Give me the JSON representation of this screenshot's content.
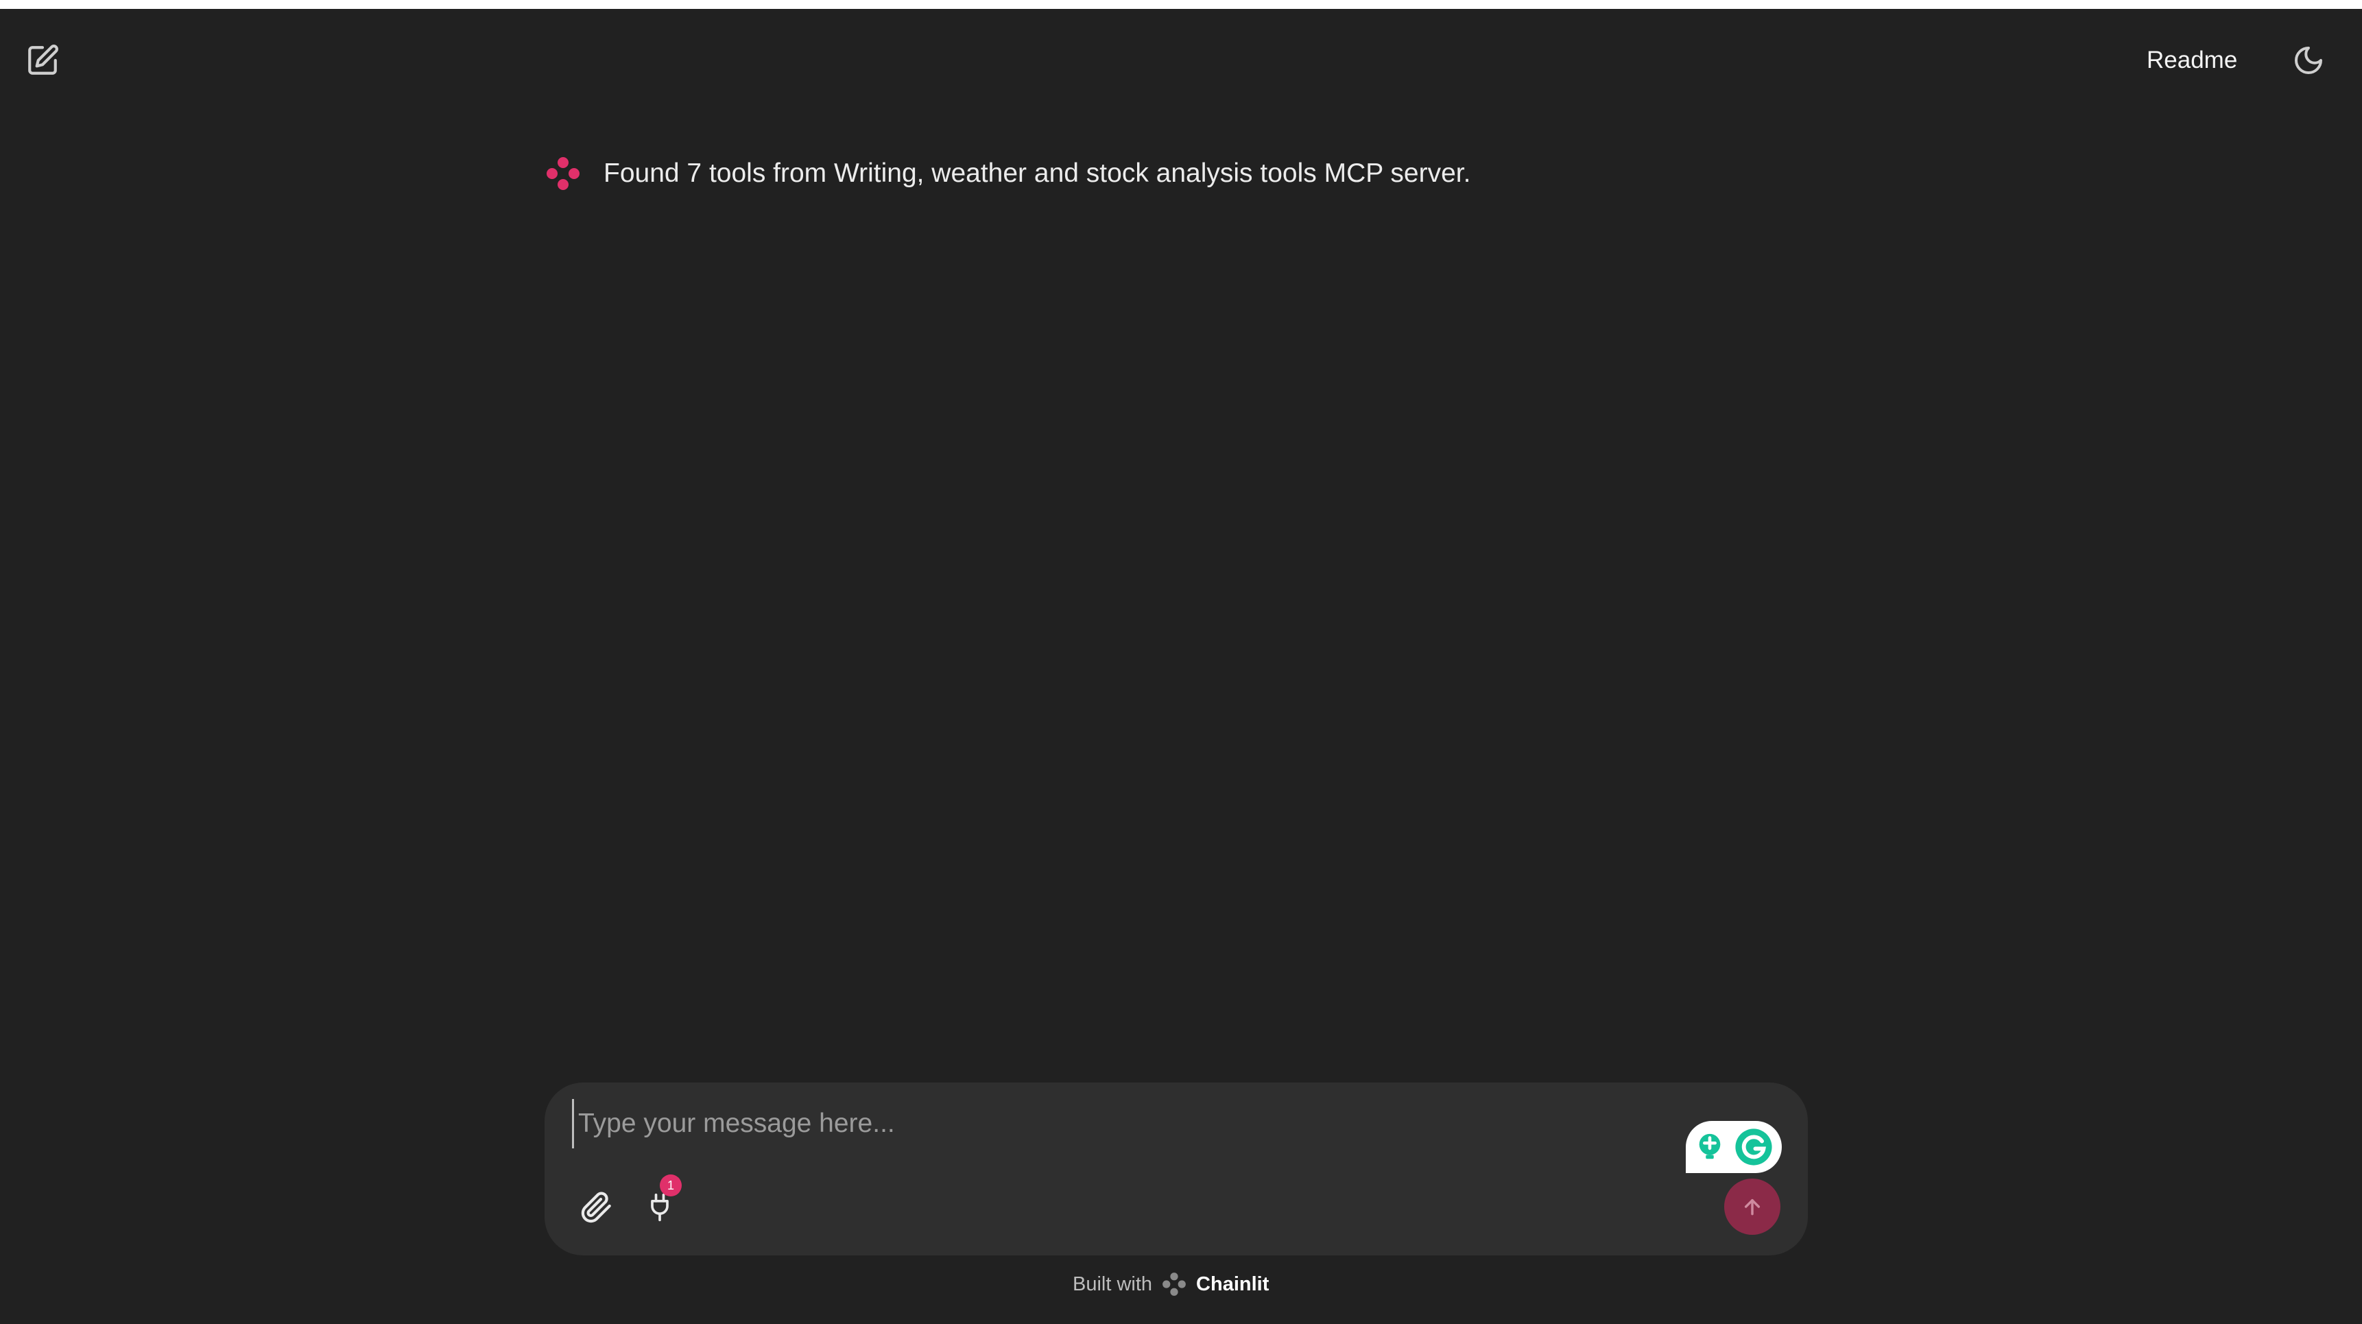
{
  "header": {
    "new_chat_icon": "edit-icon",
    "readme_label": "Readme",
    "theme_icon": "moon-icon"
  },
  "message": {
    "avatar_icon": "chainlit-logo-icon",
    "text": "Found 7 tools from Writing, weather and stock analysis tools MCP server."
  },
  "composer": {
    "placeholder": "Type your message here...",
    "value": "",
    "attach_icon": "paperclip-icon",
    "tools_icon": "plug-icon",
    "tools_badge": "1",
    "grammarly_icons": [
      "lightbulb-icon",
      "grammarly-icon"
    ],
    "send_icon": "arrow-up-icon"
  },
  "footer": {
    "prefix": "Built with",
    "brand": "Chainlit"
  },
  "colors": {
    "background": "#212121",
    "composer": "#2f2f2f",
    "accent": "#e0306a",
    "send_button": "#8b2a48",
    "grammarly": "#15c39a"
  }
}
